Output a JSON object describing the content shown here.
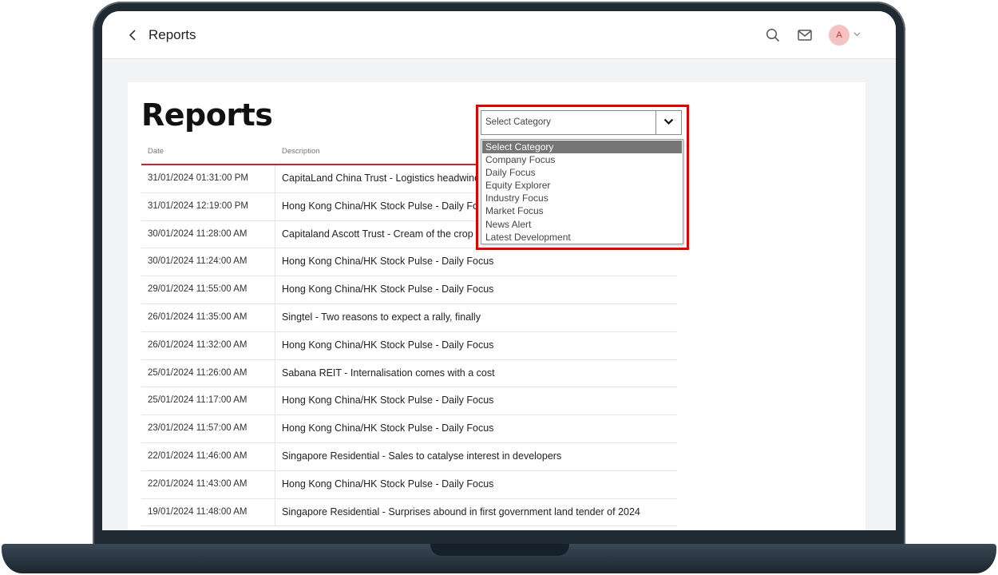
{
  "header": {
    "title": "Reports",
    "avatar_initial": "A"
  },
  "page": {
    "title": "Reports"
  },
  "table": {
    "columns": [
      "Date",
      "Description"
    ],
    "rows": [
      {
        "date": "31/01/2024 01:31:00 PM",
        "description": "CapitaLand China Trust - Logistics headwinds"
      },
      {
        "date": "31/01/2024 12:19:00 PM",
        "description": "Hong Kong China/HK Stock Pulse - Daily Focus"
      },
      {
        "date": "30/01/2024 11:28:00 AM",
        "description": "Capitaland Ascott Trust - Cream of the crop"
      },
      {
        "date": "30/01/2024 11:24:00 AM",
        "description": "Hong Kong China/HK Stock Pulse - Daily Focus"
      },
      {
        "date": "29/01/2024 11:55:00 AM",
        "description": "Hong Kong China/HK Stock Pulse - Daily Focus"
      },
      {
        "date": "26/01/2024 11:35:00 AM",
        "description": "Singtel - Two reasons to expect a rally, finally"
      },
      {
        "date": "26/01/2024 11:32:00 AM",
        "description": "Hong Kong China/HK Stock Pulse - Daily Focus"
      },
      {
        "date": "25/01/2024 11:26:00 AM",
        "description": "Sabana REIT - Internalisation comes with a cost"
      },
      {
        "date": "25/01/2024 11:17:00 AM",
        "description": "Hong Kong China/HK Stock Pulse - Daily Focus"
      },
      {
        "date": "23/01/2024 11:57:00 AM",
        "description": "Hong Kong China/HK Stock Pulse - Daily Focus"
      },
      {
        "date": "22/01/2024 11:46:00 AM",
        "description": "Singapore Residential - Sales to catalyse interest in developers"
      },
      {
        "date": "22/01/2024 11:43:00 AM",
        "description": "Hong Kong China/HK Stock Pulse - Daily Focus"
      },
      {
        "date": "19/01/2024 11:48:00 AM",
        "description": "Singapore Residential - Surprises abound in first government land tender of 2024"
      }
    ]
  },
  "category_select": {
    "selected": "Select Category",
    "options": [
      "Select Category",
      "Company Focus",
      "Daily Focus",
      "Equity Explorer",
      "Industry Focus",
      "Market Focus",
      "News Alert",
      "Latest Development"
    ]
  },
  "colors": {
    "accent": "#d0202b",
    "highlight": "#e00000",
    "laptop_frame": "#1f2a33",
    "avatar_bg": "#f5c2c4"
  },
  "icons": [
    "chevron-left-icon",
    "search-icon",
    "mail-icon",
    "chevron-down-icon"
  ]
}
